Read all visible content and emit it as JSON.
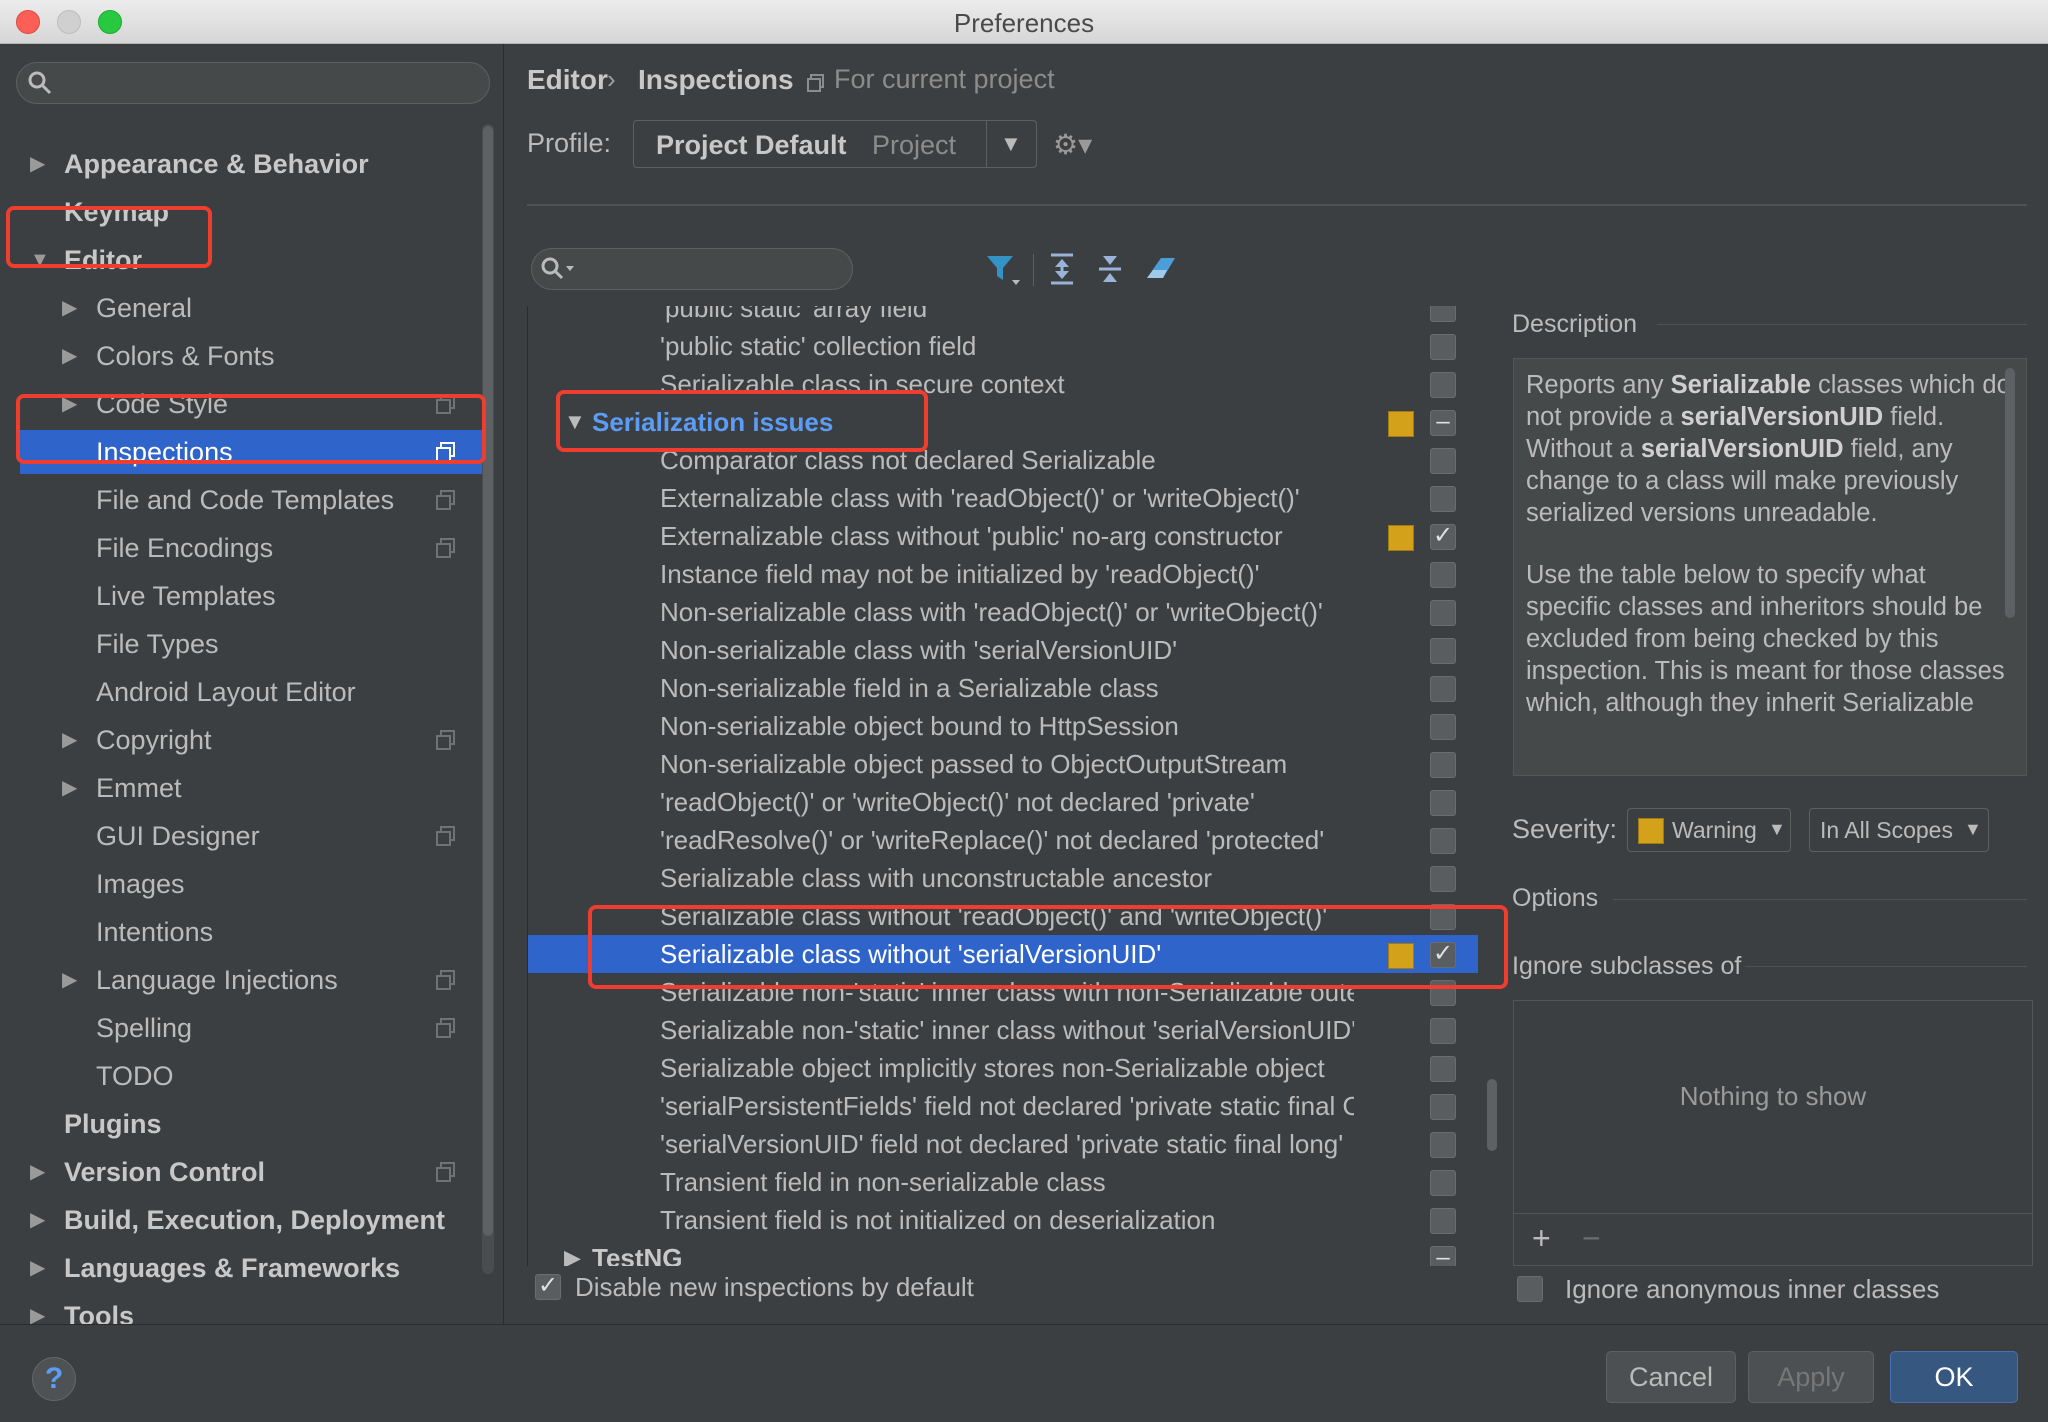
{
  "window": {
    "title": "Preferences"
  },
  "sidebar": {
    "items": [
      {
        "label": "Appearance & Behavior",
        "level": 0,
        "arrow": "▶",
        "bold": true
      },
      {
        "label": "Keymap",
        "level": 0,
        "arrow": "",
        "bold": true
      },
      {
        "label": "Editor",
        "level": 0,
        "arrow": "▼",
        "bold": true
      },
      {
        "label": "General",
        "level": 1,
        "arrow": "▶"
      },
      {
        "label": "Colors & Fonts",
        "level": 1,
        "arrow": "▶"
      },
      {
        "label": "Code Style",
        "level": 1,
        "arrow": "▶",
        "copy": true
      },
      {
        "label": "Inspections",
        "level": 1,
        "arrow": "",
        "copy": true,
        "selected": true
      },
      {
        "label": "File and Code Templates",
        "level": 1,
        "arrow": "",
        "copy": true
      },
      {
        "label": "File Encodings",
        "level": 1,
        "arrow": "",
        "copy": true
      },
      {
        "label": "Live Templates",
        "level": 1,
        "arrow": ""
      },
      {
        "label": "File Types",
        "level": 1,
        "arrow": ""
      },
      {
        "label": "Android Layout Editor",
        "level": 1,
        "arrow": ""
      },
      {
        "label": "Copyright",
        "level": 1,
        "arrow": "▶",
        "copy": true
      },
      {
        "label": "Emmet",
        "level": 1,
        "arrow": "▶"
      },
      {
        "label": "GUI Designer",
        "level": 1,
        "arrow": "",
        "copy": true
      },
      {
        "label": "Images",
        "level": 1,
        "arrow": ""
      },
      {
        "label": "Intentions",
        "level": 1,
        "arrow": ""
      },
      {
        "label": "Language Injections",
        "level": 1,
        "arrow": "▶",
        "copy": true
      },
      {
        "label": "Spelling",
        "level": 1,
        "arrow": "",
        "copy": true
      },
      {
        "label": "TODO",
        "level": 1,
        "arrow": ""
      },
      {
        "label": "Plugins",
        "level": 0,
        "arrow": "",
        "bold": true
      },
      {
        "label": "Version Control",
        "level": 0,
        "arrow": "▶",
        "bold": true,
        "copy": true
      },
      {
        "label": "Build, Execution, Deployment",
        "level": 0,
        "arrow": "▶",
        "bold": true
      },
      {
        "label": "Languages & Frameworks",
        "level": 0,
        "arrow": "▶",
        "bold": true
      },
      {
        "label": "Tools",
        "level": 0,
        "arrow": "▶",
        "bold": true
      }
    ]
  },
  "breadcrumb": {
    "editor": "Editor",
    "sep": "›",
    "inspections": "Inspections",
    "scope": "For current project"
  },
  "profile": {
    "label": "Profile:",
    "name": "Project Default",
    "scope": "Project"
  },
  "inspections": [
    {
      "label": "'public static' array field",
      "indent": 2,
      "cb": ""
    },
    {
      "label": "'public static' collection field",
      "indent": 2,
      "cb": ""
    },
    {
      "label": "Serializable class in secure context",
      "indent": 2,
      "cb": ""
    },
    {
      "label": "Serialization issues",
      "indent": 1,
      "group": "hl",
      "arrow": "▼",
      "sev": true,
      "cb": "–"
    },
    {
      "label": "Comparator class not declared Serializable",
      "indent": 2,
      "cb": ""
    },
    {
      "label": "Externalizable class with 'readObject()' or 'writeObject()'",
      "indent": 2,
      "cb": ""
    },
    {
      "label": "Externalizable class without 'public' no-arg constructor",
      "indent": 2,
      "sev": true,
      "cb": "✓"
    },
    {
      "label": "Instance field may not be initialized by 'readObject()'",
      "indent": 2,
      "cb": ""
    },
    {
      "label": "Non-serializable class with 'readObject()' or 'writeObject()'",
      "indent": 2,
      "cb": ""
    },
    {
      "label": "Non-serializable class with 'serialVersionUID'",
      "indent": 2,
      "cb": ""
    },
    {
      "label": "Non-serializable field in a Serializable class",
      "indent": 2,
      "cb": ""
    },
    {
      "label": "Non-serializable object bound to HttpSession",
      "indent": 2,
      "cb": ""
    },
    {
      "label": "Non-serializable object passed to ObjectOutputStream",
      "indent": 2,
      "cb": ""
    },
    {
      "label": "'readObject()' or 'writeObject()' not declared 'private'",
      "indent": 2,
      "cb": ""
    },
    {
      "label": "'readResolve()' or 'writeReplace()' not declared 'protected'",
      "indent": 2,
      "cb": ""
    },
    {
      "label": "Serializable class with unconstructable ancestor",
      "indent": 2,
      "cb": ""
    },
    {
      "label": "Serializable class without 'readObject()' and 'writeObject()'",
      "indent": 2,
      "cb": ""
    },
    {
      "label": "Serializable class without 'serialVersionUID'",
      "indent": 2,
      "sev": true,
      "cb": "✓",
      "selected": true
    },
    {
      "label": "Serializable non-'static' inner class with non-Serializable outer class",
      "indent": 2,
      "cb": ""
    },
    {
      "label": "Serializable non-'static' inner class without 'serialVersionUID'",
      "indent": 2,
      "cb": ""
    },
    {
      "label": "Serializable object implicitly stores non-Serializable object",
      "indent": 2,
      "cb": ""
    },
    {
      "label": "'serialPersistentFields' field not declared 'private static final ObjectStreamField[]'",
      "indent": 2,
      "cb": ""
    },
    {
      "label": "'serialVersionUID' field not declared 'private static final long'",
      "indent": 2,
      "cb": ""
    },
    {
      "label": "Transient field in non-serializable class",
      "indent": 2,
      "cb": ""
    },
    {
      "label": "Transient field is not initialized on deserialization",
      "indent": 2,
      "cb": ""
    },
    {
      "label": "TestNG",
      "indent": 1,
      "group": "normal",
      "arrow": "▶",
      "cb": "–"
    }
  ],
  "disable_new": {
    "label": "Disable new inspections by default",
    "checked": "✓"
  },
  "description": {
    "title": "Description",
    "p1_a": "Reports any ",
    "p1_b": "Serializable",
    "p1_c": " classes which do not provide a ",
    "p1_d": "serialVersionUID",
    "p1_e": " field. Without a ",
    "p1_f": "serialVersionUID",
    "p1_g": " field, any change to a class will make previously serialized versions unreadable.",
    "p2": "Use the table below to specify what specific classes and inheritors should be excluded from being checked by this inspection. This is meant for those classes which, although they inherit Serializable"
  },
  "severity": {
    "label": "Severity:",
    "value": "Warning",
    "scope": "In All Scopes",
    "color": "#d4a21a"
  },
  "options": {
    "title": "Options",
    "ignore_title": "Ignore subclasses of",
    "empty": "Nothing to show",
    "add": "+",
    "remove": "−",
    "anon_label": "Ignore anonymous inner classes"
  },
  "buttons": {
    "help": "?",
    "cancel": "Cancel",
    "apply": "Apply",
    "ok": "OK"
  },
  "colors": {
    "accent": "#2f65ca",
    "annotation": "#ef3d2f",
    "group_highlight": "#5c9cf5",
    "warning": "#d4a21a"
  }
}
